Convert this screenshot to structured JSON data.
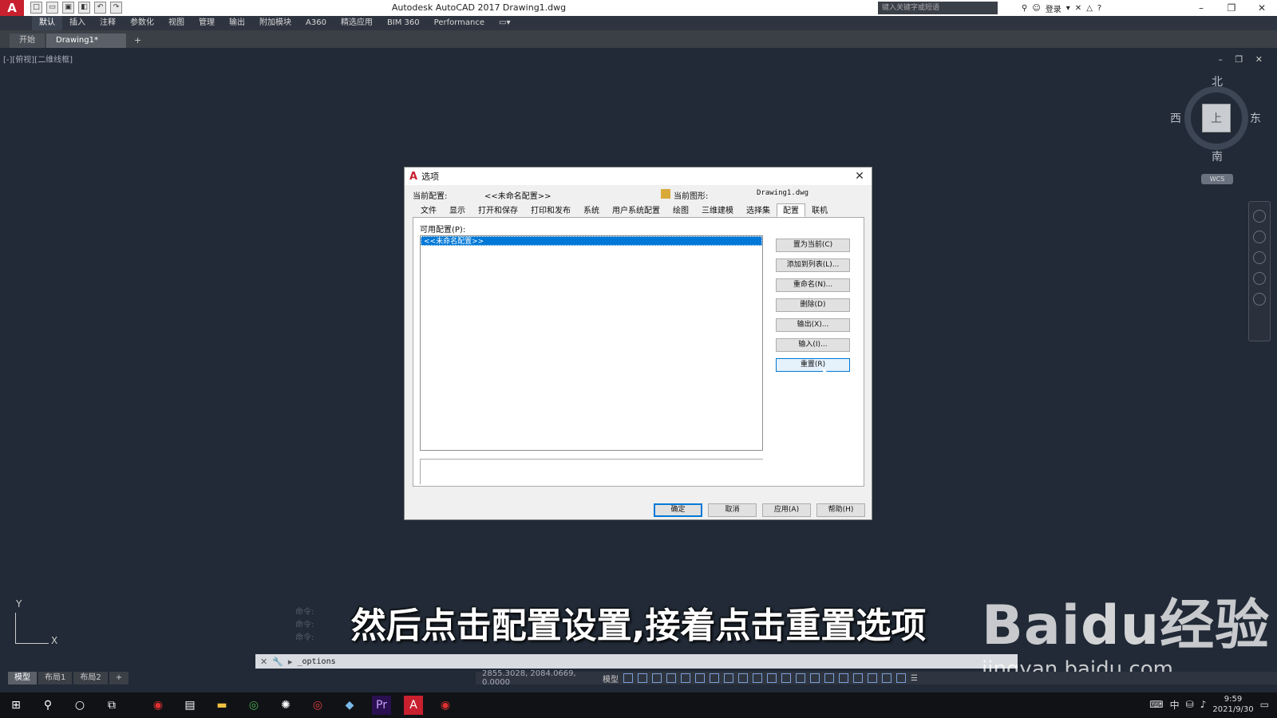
{
  "titlebar": {
    "title": "Autodesk AutoCAD 2017    Drawing1.dwg",
    "search_placeholder": "键入关键字或短语",
    "login": "登录",
    "logo": "A"
  },
  "ribbon": {
    "tabs": [
      "默认",
      "插入",
      "注释",
      "参数化",
      "视图",
      "管理",
      "输出",
      "附加模块",
      "A360",
      "精选应用",
      "BIM 360",
      "Performance"
    ]
  },
  "doc_tabs": {
    "start": "开始",
    "drawing": "Drawing1*"
  },
  "viewport": {
    "label": "[-][俯视][二维线框]",
    "viewcube": {
      "top": "上",
      "north": "北",
      "south": "南",
      "east": "东",
      "west": "西"
    },
    "wcs": "WCS",
    "ucs_x": "X",
    "ucs_y": "Y"
  },
  "command": {
    "history": [
      "命令:",
      "命令:",
      "命令:"
    ],
    "current": "_options"
  },
  "subtitle": "然后点击配置设置,接着点击重置选项",
  "watermark": {
    "logo": "Bai",
    "logo2": "du",
    "logo3": "经验",
    "url": "jingyan.baidu.com"
  },
  "layout_tabs": [
    "模型",
    "布局1",
    "布局2"
  ],
  "status": {
    "coords": "2855.3028, 2084.0669, 0.0000",
    "model": "模型"
  },
  "dialog": {
    "title": "选项",
    "current_profile_label": "当前配置:",
    "current_profile_value": "<<未命名配置>>",
    "current_drawing_label": "当前图形:",
    "current_drawing_value": "Drawing1.dwg",
    "tabs": [
      "文件",
      "显示",
      "打开和保存",
      "打印和发布",
      "系统",
      "用户系统配置",
      "绘图",
      "三维建模",
      "选择集",
      "配置",
      "联机"
    ],
    "active_tab": "配置",
    "available_label": "可用配置(P):",
    "profiles": [
      "<<未命名配置>>"
    ],
    "buttons": {
      "set_current": "置为当前(C)",
      "add_to_list": "添加到列表(L)...",
      "rename": "重命名(N)...",
      "delete": "删除(D)",
      "export": "输出(X)...",
      "import": "输入(I)...",
      "reset": "重置(R)"
    },
    "bottom": {
      "ok": "确定",
      "cancel": "取消",
      "apply": "应用(A)",
      "help": "帮助(H)"
    }
  },
  "taskbar": {
    "time": "9:59",
    "date": "2021/9/30",
    "ime": "中"
  },
  "colors": {
    "accent": "#0078d7",
    "autocad_red": "#c8202e",
    "canvas": "#212a36"
  }
}
